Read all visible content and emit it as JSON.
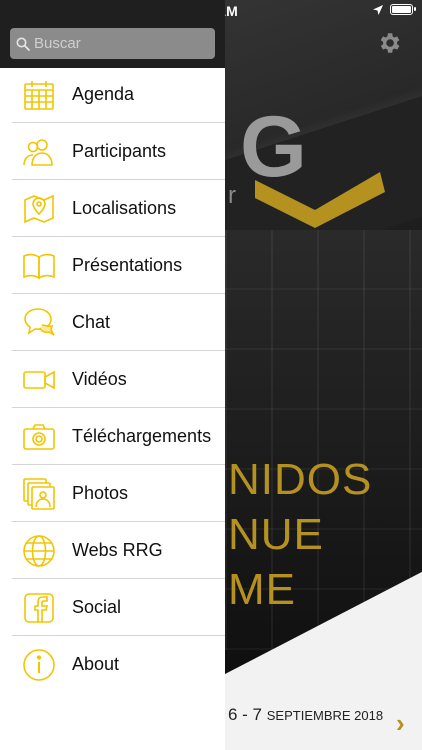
{
  "status_bar": {
    "time": "AM"
  },
  "background": {
    "logo_letter": "G",
    "logo_sub": "r",
    "hero_lines": [
      "NIDOS",
      "NUE",
      "ME"
    ],
    "date_days": "6 - 7",
    "date_month_year": "SEPTIEMBRE 2018",
    "next_arrow": "›"
  },
  "search": {
    "placeholder": "Buscar",
    "value": ""
  },
  "menu": {
    "items": [
      {
        "label": "Agenda",
        "icon": "calendar-icon"
      },
      {
        "label": "Participants",
        "icon": "people-icon"
      },
      {
        "label": "Localisations",
        "icon": "map-pin-icon"
      },
      {
        "label": "Présentations",
        "icon": "book-icon"
      },
      {
        "label": "Chat",
        "icon": "chat-icon"
      },
      {
        "label": "Vidéos",
        "icon": "video-icon"
      },
      {
        "label": "Téléchargements",
        "icon": "camera-icon"
      },
      {
        "label": "Photos",
        "icon": "photos-icon"
      },
      {
        "label": "Webs RRG",
        "icon": "globe-icon"
      },
      {
        "label": "Social",
        "icon": "facebook-icon"
      },
      {
        "label": "About",
        "icon": "info-icon"
      }
    ]
  },
  "colors": {
    "accent": "#F2C500",
    "hero_gold": "#B59220",
    "drawer_header": "#1F1F1F"
  }
}
